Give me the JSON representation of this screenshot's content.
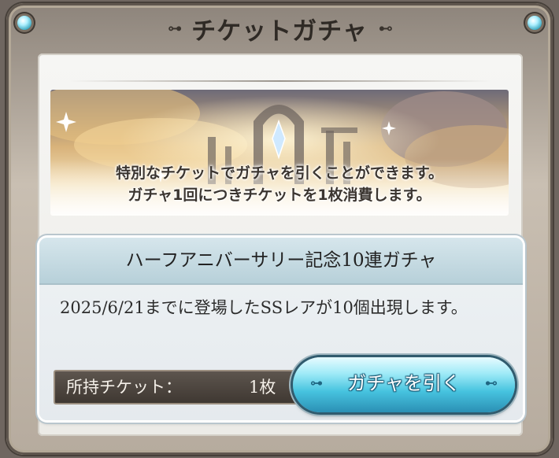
{
  "dialog": {
    "title": "チケットガチャ",
    "title_ornament_left": "⊶",
    "title_ornament_right": "⊷"
  },
  "banner": {
    "line1": "特別なチケットでガチャを引くことができます。",
    "line2": "ガチャ1回につきチケットを1枚消費します。"
  },
  "card": {
    "title": "ハーフアニバーサリー記念10連ガチャ",
    "description": "2025/6/21までに登場したSSレアが10個出現します。",
    "ticket_label": "所持チケット：",
    "ticket_count": "1枚",
    "draw_button_label": "ガチャを引く",
    "button_ornament_left": "⊶",
    "button_ornament_right": "⊷"
  },
  "colors": {
    "frame": "#8d847b",
    "panel": "#f6f6f4",
    "card_header": "#b7d0d9",
    "ticket_bar": "#4a423b",
    "button_accent": "#46c3df"
  }
}
